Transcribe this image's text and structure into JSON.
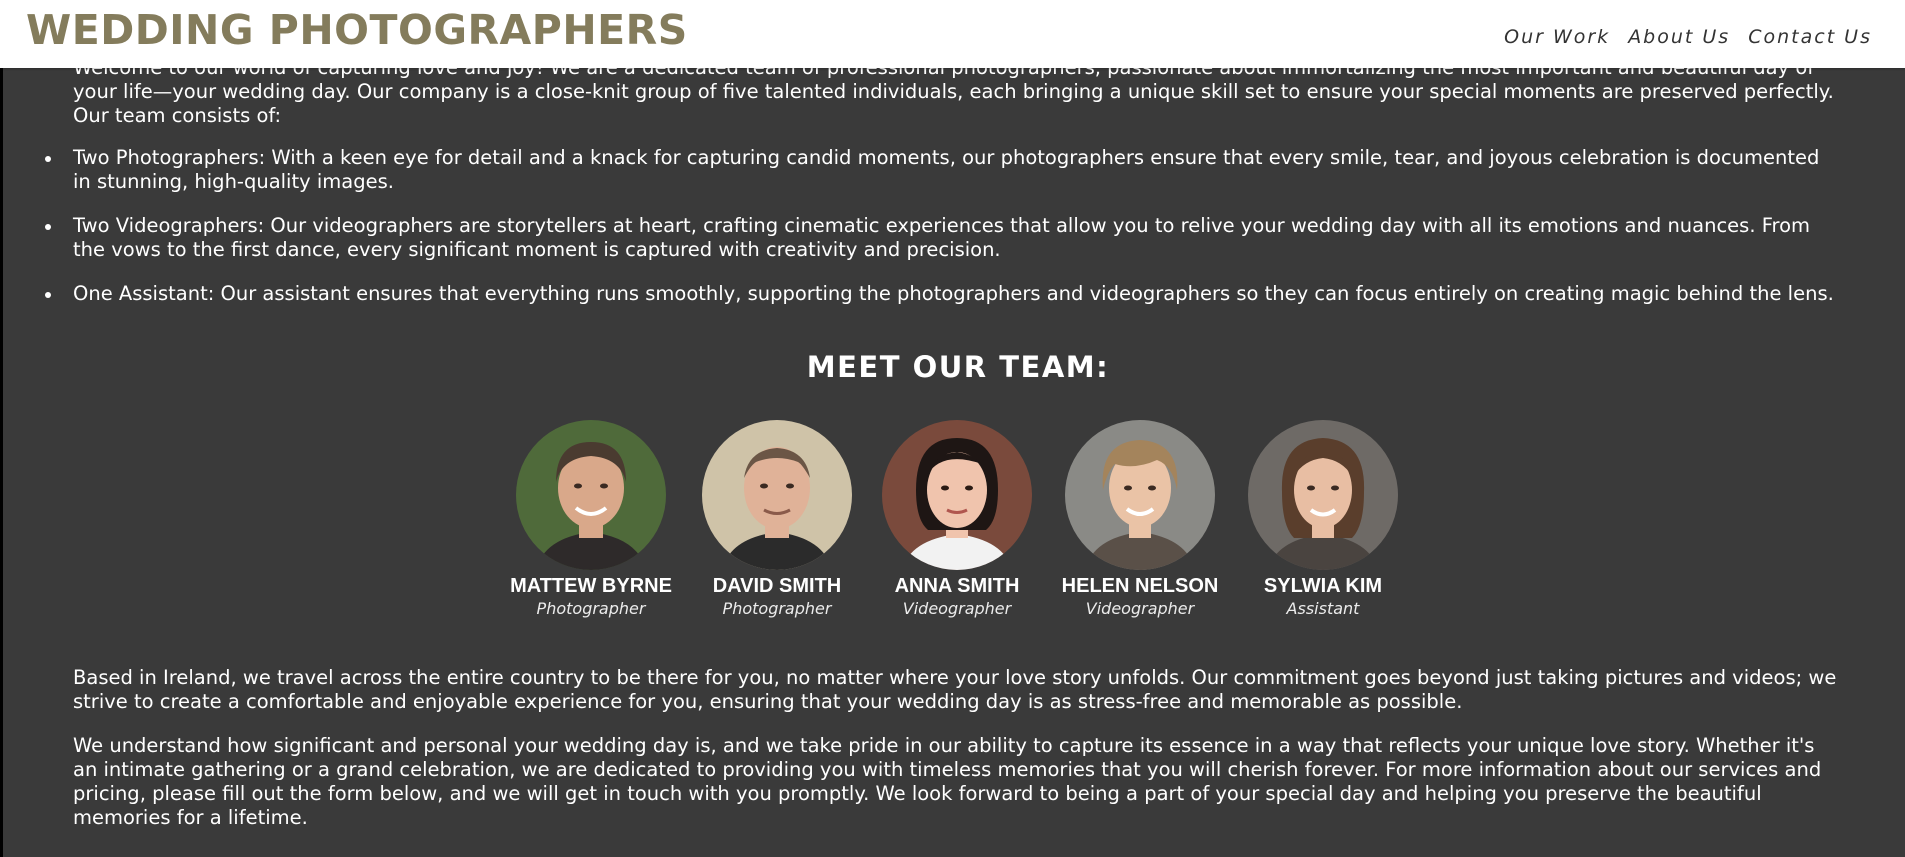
{
  "header": {
    "brand": "WEDDING PHOTOGRAPHERS",
    "nav": [
      "Our Work",
      "About Us",
      "Contact Us"
    ]
  },
  "intro": "Welcome to our world of capturing love and joy! We are a dedicated team of professional photographers, passionate about immortalizing the most important and beautiful day of your life—your wedding day. Our company is a close-knit group of five talented individuals, each bringing a unique skill set to ensure your special moments are preserved perfectly. Our team consists of:",
  "roles": [
    "Two Photographers: With a keen eye for detail and a knack for capturing candid moments, our photographers ensure that every smile, tear, and joyous celebration is documented in stunning, high-quality images.",
    "Two Videographers: Our videographers are storytellers at heart, crafting cinematic experiences that allow you to relive your wedding day with all its emotions and nuances. From the vows to the first dance, every significant moment is captured with creativity and precision.",
    "One Assistant: Our assistant ensures that everything runs smoothly, supporting the photographers and videographers so they can focus entirely on creating magic behind the lens."
  ],
  "team_heading": "MEET OUR TEAM:",
  "team": [
    {
      "name": "MATTEW BYRNE",
      "role": "Photographer",
      "bg": "#4f6a3a",
      "skin": "#d9a88a",
      "hair": "#4a3b30"
    },
    {
      "name": "DAVID SMITH",
      "role": "Photographer",
      "bg": "#cfc3a8",
      "skin": "#e0b298",
      "hair": "#6b5646"
    },
    {
      "name": "ANNA SMITH",
      "role": "Videographer",
      "bg": "#7a4a3c",
      "skin": "#f0c4ad",
      "hair": "#1e1614"
    },
    {
      "name": "HELEN NELSON",
      "role": "Videographer",
      "bg": "#8a8a86",
      "skin": "#eac3a6",
      "hair": "#a4845c"
    },
    {
      "name": "SYLWIA KIM",
      "role": "Assistant",
      "bg": "#6e6a66",
      "skin": "#e8bea3",
      "hair": "#5a3e2c"
    }
  ],
  "paragraphs": [
    "Based in Ireland, we travel across the entire country to be there for you, no matter where your love story unfolds. Our commitment goes beyond just taking pictures and videos; we strive to create a comfortable and enjoyable experience for you, ensuring that your wedding day is as stress-free and memorable as possible.",
    "We understand how significant and personal your wedding day is, and we take pride in our ability to capture its essence in a way that reflects your unique love story. Whether it's an intimate gathering or a grand celebration, we are dedicated to providing you with timeless memories that you will cherish forever. For more information about our services and pricing, please fill out the form below, and we will get in touch with you promptly. We look forward to being a part of your special day and helping you preserve the beautiful memories for a lifetime."
  ]
}
